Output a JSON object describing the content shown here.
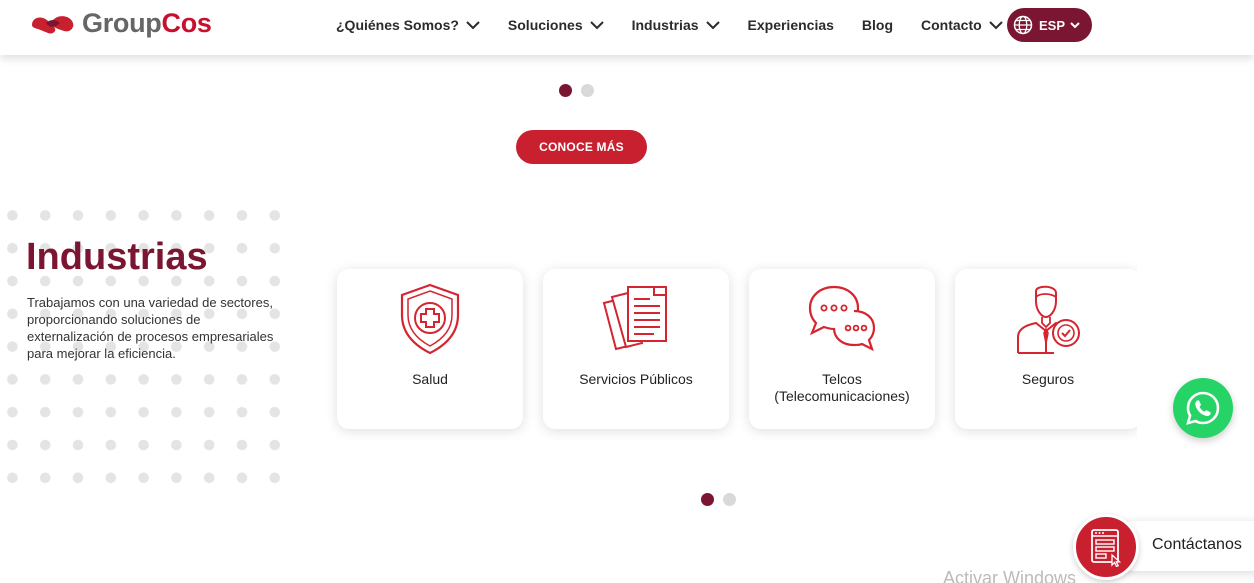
{
  "header": {
    "logo_group": "Group",
    "logo_cos": "Cos",
    "nav": [
      {
        "label": "¿Quiénes Somos?",
        "has_dropdown": true
      },
      {
        "label": "Soluciones",
        "has_dropdown": true
      },
      {
        "label": "Industrias",
        "has_dropdown": true
      },
      {
        "label": "Experiencias",
        "has_dropdown": false
      },
      {
        "label": "Blog",
        "has_dropdown": false
      },
      {
        "label": "Contacto",
        "has_dropdown": true
      }
    ],
    "language": "ESP",
    "language_icon": "globe-icon"
  },
  "hero": {
    "cta_label": "CONOCE MÁS",
    "slider_dots": {
      "count": 2,
      "active": 0
    }
  },
  "industries": {
    "title": "Industrias",
    "description": "Trabajamos con una variedad de sectores, proporcionando soluciones de externalización de procesos empresariales para mejorar la eficiencia.",
    "cards": [
      {
        "label": "Salud",
        "icon": "health-shield-icon"
      },
      {
        "label": "Servicios Públicos",
        "icon": "documents-icon"
      },
      {
        "label": "Telcos (Telecomunicaciones)",
        "icon": "chat-bubbles-icon"
      },
      {
        "label": "Seguros",
        "icon": "insurance-agent-icon"
      }
    ],
    "slider_dots": {
      "count": 2,
      "active": 0
    }
  },
  "floating": {
    "whatsapp_icon": "whatsapp-icon",
    "contact_label": "Contáctanos",
    "contact_icon": "contact-form-icon"
  },
  "watermark": "Activar Windows",
  "colors": {
    "brand_maroon": "#7a1631",
    "brand_red": "#c8202f",
    "whatsapp_green": "#25d366"
  }
}
